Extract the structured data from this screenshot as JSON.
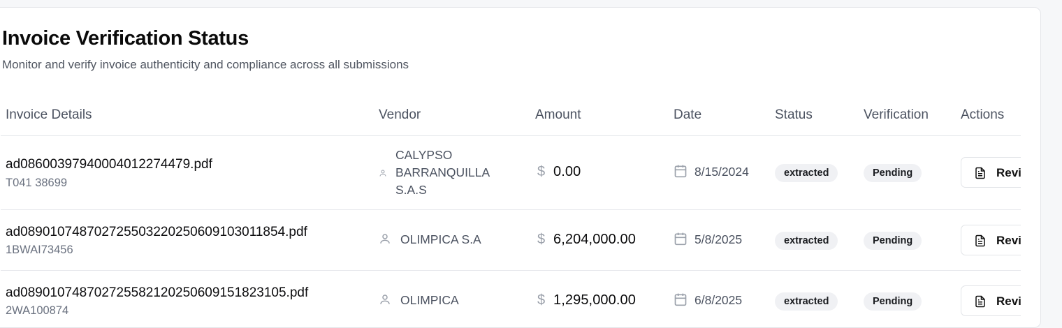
{
  "page": {
    "title": "Invoice Verification Status",
    "subtitle": "Monitor and verify invoice authenticity and compliance across all submissions"
  },
  "table": {
    "headers": {
      "invoice_details": "Invoice Details",
      "vendor": "Vendor",
      "amount": "Amount",
      "date": "Date",
      "status": "Status",
      "verification": "Verification",
      "actions": "Actions"
    },
    "currency_symbol": "$",
    "action_label": "Review",
    "rows": [
      {
        "file": "ad08600397940004012274479.pdf",
        "invoice_no": "T041 38699",
        "vendor_lines": [
          "CALYPSO",
          "BARRANQUILLA",
          "S.A.S"
        ],
        "amount": "$0.00",
        "date": "8/15/2024",
        "status": "extracted",
        "verification": "Pending"
      },
      {
        "file": "ad08901074870272550322025060910301185​4.pdf",
        "invoice_no": "1BWAI73456",
        "vendor": "OLIMPICA S.A",
        "amount": "$6,204,000.00",
        "date": "5/8/2025",
        "status": "extracted",
        "verification": "Pending"
      },
      {
        "file": "ad089010748702725582120250609151823105.pdf",
        "invoice_no": "2WA100874",
        "vendor": "OLIMPICA",
        "amount": "$1,295,000.00",
        "date": "6/8/2025",
        "status": "extracted",
        "verification": "Pending"
      }
    ]
  },
  "icons": {
    "vendor": "user-icon",
    "amount": "dollar-sign-icon",
    "date": "calendar-icon",
    "action": "document-icon"
  },
  "colors": {
    "badge_bg": "#f0f1f4",
    "muted_text": "#4b5260",
    "border": "#e6e8ec"
  }
}
